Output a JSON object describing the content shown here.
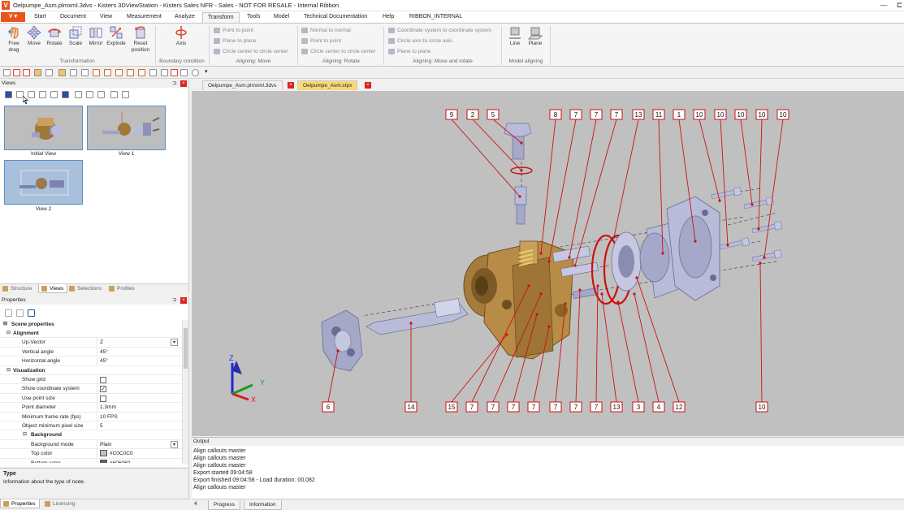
{
  "window": {
    "title": "Oelpumpe_Asm.plmxml.3dvs - Kisters 3DViewStation - Kisters Sales NFR - Sales - NOT FOR RESALE - Internal Ribbon",
    "minimize": "—",
    "close": "⊏"
  },
  "menu": {
    "app_button": "V ▾",
    "tabs": [
      "Start",
      "Document",
      "View",
      "Measurement",
      "Analyze",
      "Transform",
      "Tools",
      "Model",
      "Technical Documentation",
      "Help",
      "RIBBON_INTERNAL"
    ],
    "active": "Transform"
  },
  "ribbon": {
    "transformation": {
      "label": "Transformation",
      "buttons": [
        "Free drag",
        "Move",
        "Rotate",
        "Scale",
        "Mirror",
        "Explode",
        "Reset position"
      ]
    },
    "boundary": {
      "label": "Boundary condition",
      "button": "Axis"
    },
    "aligning_move": {
      "label": "Aligning: Move",
      "items": [
        "Point to point",
        "Plane to plane",
        "Circle center to circle center"
      ]
    },
    "aligning_rotate": {
      "label": "Aligning: Rotate",
      "items": [
        "Normal to normal",
        "Point to point",
        "Circle center to circle center"
      ]
    },
    "aligning_move_rotate": {
      "label": "Aligning: Move and rotate",
      "items": [
        "Coordinate system to coordinate system",
        "Circle axis to circle axis",
        "Plane to plane"
      ]
    },
    "model_aligning": {
      "label": "Model aligning",
      "buttons": [
        "Line",
        "Plane"
      ]
    }
  },
  "views_panel": {
    "title": "Views",
    "pin": "⊐",
    "close": "×",
    "views": [
      "Initial View",
      "View 1",
      "View 2"
    ],
    "tabs": [
      "Structure",
      "Views",
      "Selections",
      "Profiles"
    ],
    "active_tab": "Views"
  },
  "properties_panel": {
    "title": "Properties",
    "pin": "⊐",
    "close": "×",
    "root": "Scene properties",
    "rows": [
      {
        "kind": "group",
        "label": "Alignment"
      },
      {
        "kind": "row",
        "label": "Up-Vector",
        "value": "Z",
        "dropdown": true
      },
      {
        "kind": "row",
        "label": "Vertical angle",
        "value": "45°"
      },
      {
        "kind": "row",
        "label": "Horizontal angle",
        "value": "45°"
      },
      {
        "kind": "group",
        "label": "Visualization"
      },
      {
        "kind": "check",
        "label": "Show grid",
        "value": false
      },
      {
        "kind": "check",
        "label": "Show coordinate system",
        "value": true
      },
      {
        "kind": "check",
        "label": "Use point size",
        "value": false
      },
      {
        "kind": "row",
        "label": "Point diameter",
        "value": "1.3mm"
      },
      {
        "kind": "row",
        "label": "Minimum frame rate (fps)",
        "value": "10 FPS"
      },
      {
        "kind": "row",
        "label": "Object minimum pixel size",
        "value": "5"
      },
      {
        "kind": "group2",
        "label": "Background"
      },
      {
        "kind": "row",
        "label": "Background mode",
        "value": "Plain",
        "dropdown": true
      },
      {
        "kind": "color",
        "label": "Top color",
        "value": "#C0C0C0",
        "swatch": "#c0c0c0"
      },
      {
        "kind": "color",
        "label": "Bottom color",
        "value": "#606060",
        "swatch": "#606060"
      }
    ],
    "type_title": "Type",
    "type_desc": "Information about the type of node.",
    "bottom_tabs": [
      "Properties",
      "Licensing"
    ]
  },
  "documents": {
    "tabs": [
      {
        "label": "Oelpumpe_Asm.plmxml.3dvs",
        "active": false
      },
      {
        "label": "Oelpumpe_Asm.stpx",
        "active": true
      }
    ]
  },
  "viewport": {
    "background": "#c0c0c0",
    "callout_color": "#cc1111",
    "callouts_top": [
      "9",
      "2",
      "5",
      "8",
      "7",
      "7",
      "7",
      "13",
      "11",
      "1",
      "10",
      "10",
      "10",
      "10",
      "10"
    ],
    "callouts_bottom": [
      "6",
      "14",
      "15",
      "7",
      "7",
      "7",
      "7",
      "7",
      "7",
      "7",
      "13",
      "3",
      "4",
      "12",
      "10"
    ],
    "axes": {
      "z": "Z",
      "y": "Y",
      "x": "X"
    }
  },
  "output": {
    "title": "Output",
    "lines": [
      "Align callouts master",
      "Align callouts master",
      "Align callouts master",
      "Export started 09:04:58",
      "Export finished 09:04:58 - Load duration: 00.082",
      "Align callouts master"
    ],
    "tab_prefix": "4",
    "tabs": [
      "Progress",
      "Information"
    ]
  }
}
